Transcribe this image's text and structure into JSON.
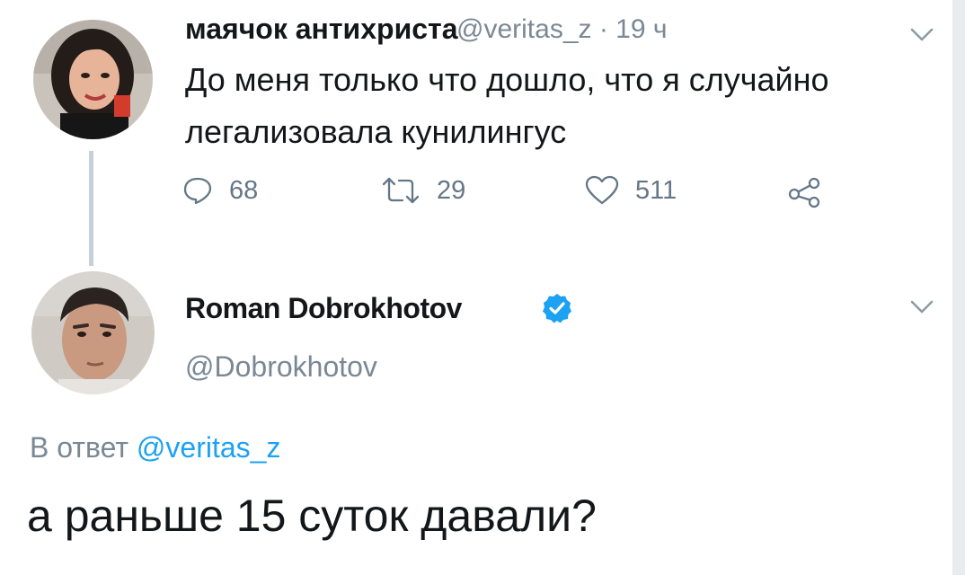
{
  "tweet1": {
    "author_name": "маячок антихриста",
    "handle": "@veritas_z",
    "separator": " · ",
    "time": "19 ч",
    "text": "До меня только что дошло, что я случайно легализовала кунилингус",
    "actions": {
      "replies": "68",
      "retweets": "29",
      "likes": "511"
    },
    "avatar_icon": "avatar-woman-icon"
  },
  "tweet2": {
    "author_name": "Roman Dobrokhotov",
    "handle": "@Dobrokhotov",
    "verified_icon": "verified-badge-icon",
    "avatar_icon": "avatar-man-icon",
    "reply_prefix": "В ответ ",
    "reply_mention": "@veritas_z",
    "text": "а раньше 15 суток давали?"
  },
  "colors": {
    "text": "#14171a",
    "secondary": "#657786",
    "accent": "#1da1f2",
    "thread_line": "#c6d0d8"
  }
}
